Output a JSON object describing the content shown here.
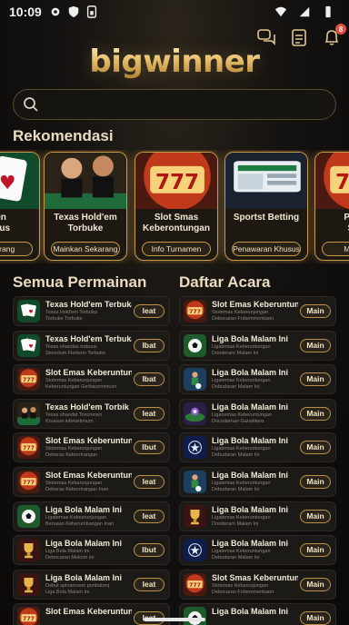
{
  "status": {
    "time": "10:09"
  },
  "header": {
    "logo": "bigwinner",
    "notification_count": "8"
  },
  "search": {
    "placeholder": ""
  },
  "sections": {
    "recommend": "Rekomendasi",
    "all_games": "Semua Permainan",
    "events": "Daftar Acara"
  },
  "recommend": [
    {
      "title": "nen\nenius",
      "button": "Sekarang",
      "art": "cards"
    },
    {
      "title": "Texas Hold'em\nTorbuke",
      "button": "Mainkan Sekarang",
      "art": "dealers"
    },
    {
      "title": "Slot Smas\nKeberontungan",
      "button": "Info Turnamen",
      "art": "slot"
    },
    {
      "title": "Sportst Betting",
      "button": "Penawaran Khusus",
      "art": "betting"
    },
    {
      "title": "Perke\nSlot",
      "button": "Mainka",
      "art": "slot2"
    }
  ],
  "games": [
    {
      "title": "Texas Hold'em Terbuka",
      "sub": "Texas Hold'em Terbuka\nTorbuke Torbuke",
      "button": "Ieat",
      "thumb": "cards"
    },
    {
      "title": "Texas Hold'em Terbuka",
      "sub": "Texas shaodas trabuus\nStoonlom Florbom Torbuke",
      "button": "Ibat",
      "thumb": "cards2"
    },
    {
      "title": "Slot Emas Keberuntungan",
      "sub": "Stotemas Kebarunjungan\nKeberuntungan Gerbacemmusn",
      "button": "Ibat",
      "thumb": "slot"
    },
    {
      "title": "Texas Hold'em Torbik",
      "sub": "Texas shaodat Toscrenen\nKnuvust arbrtartimum",
      "button": "Ieat",
      "thumb": "dealer"
    },
    {
      "title": "Slot Emas Keberuntungan",
      "sub": "Stotemas Kebarunjungan\nDeberas Keberrirangan",
      "button": "Ibut",
      "thumb": "slot2"
    },
    {
      "title": "Slot Emas Keberuntungan",
      "sub": "Stotemas Kebarunjungan\nDeberas Keberrirangan Inan",
      "button": "Ieat",
      "thumb": "slot3"
    },
    {
      "title": "Liga Bola Malam Ini",
      "sub": "Ligatemas Kebesrunjungan\nBeruaan Keberumbangan Inan",
      "button": "Ieat",
      "thumb": "football"
    },
    {
      "title": "Liga Bola Malam Ini",
      "sub": "Liga Bola Malam Ini\nDebocaran Moloim Ini",
      "button": "Ibut",
      "thumb": "trophy"
    },
    {
      "title": "Liga Bola Malam Ini",
      "sub": "Debut spinanosnn ponbatonj\nLiga Bola Malam Ini",
      "button": "Ieat",
      "thumb": "trophy2"
    },
    {
      "title": "Slot Emas Keberuntungan",
      "sub": "",
      "button": "Ieat",
      "thumb": "slot"
    }
  ],
  "events": [
    {
      "title": "Slot Emas Keberuntungan",
      "sub": "Stotemas Kebarunjungan\nDebocaran Fobemmenkaon",
      "button": "Main",
      "thumb": "slot"
    },
    {
      "title": "Liga Bola Malam Ini",
      "sub": "Ligatemas Keberuntungan\nDooderarn Malam Ini",
      "button": "Main",
      "thumb": "football"
    },
    {
      "title": "Liga Bola Malam Ini",
      "sub": "Ligatemas Keberuntungan\nDebudaran Malam Ini",
      "button": "Main",
      "thumb": "player"
    },
    {
      "title": "Liga Bola Malam Ini",
      "sub": "Liganemas Keberuntungan\nDocodarnan Ganatilans",
      "button": "Main",
      "thumb": "stadium"
    },
    {
      "title": "Liga Bola Malam Ini",
      "sub": "Ligatemas Keberuntungan\nDebudaran Malam Ini",
      "button": "Main",
      "thumb": "ucl"
    },
    {
      "title": "Liga Bola Malam Ini",
      "sub": "Ligatemas Keberuntungan\nDebudaran Malam Ini",
      "button": "Main",
      "thumb": "player"
    },
    {
      "title": "Liga Bola Malam Ini",
      "sub": "Ligatemas Keberuntungan\nDooderarn Malam Ini",
      "button": "Main",
      "thumb": "trophy"
    },
    {
      "title": "Liga Bola Malam Ini",
      "sub": "Ligatemas Keberuntungan\nDebudaran Malam Ini",
      "button": "Main",
      "thumb": "ucl"
    },
    {
      "title": "Slot Smas Keberuntungan",
      "sub": "Stotemas Kebarunjungan\nDebocaran Fobemmenkaon",
      "button": "Main",
      "thumb": "slot2"
    },
    {
      "title": "Liga Bola Malam Ini",
      "sub": "",
      "button": "Main",
      "thumb": "football"
    }
  ]
}
